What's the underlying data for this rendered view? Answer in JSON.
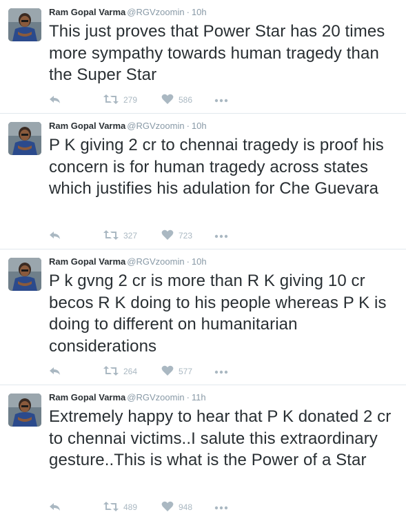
{
  "author": {
    "fullname": "Ram Gopal Varma",
    "username": "@RGVzoomin",
    "avatar_icon": "user-avatar"
  },
  "icons": {
    "reply": "reply-icon",
    "retweet": "retweet-icon",
    "like": "heart-icon",
    "more": "more-dots-icon"
  },
  "tweets": [
    {
      "time": "10h",
      "text": "This just proves that Power Star has 20 times more sympathy towards human tragedy than the Super Star",
      "retweets": "279",
      "likes": "586"
    },
    {
      "time": "10h",
      "text": "P K giving 2 cr to chennai tragedy is proof his concern is for human tragedy across states which justifies his adulation for Che Guevara",
      "retweets": "327",
      "likes": "723"
    },
    {
      "time": "10h",
      "text": "P k gvng 2 cr is more than R K giving 10 cr becos R K doing to his people whereas P K is doing to different on humanitarian considerations",
      "retweets": "264",
      "likes": "577"
    },
    {
      "time": "11h",
      "text": "Extremely happy to hear that P K donated 2 cr to chennai victims..I salute this extraordinary gesture..This is what is the Power of a Star",
      "retweets": "489",
      "likes": "948"
    }
  ]
}
